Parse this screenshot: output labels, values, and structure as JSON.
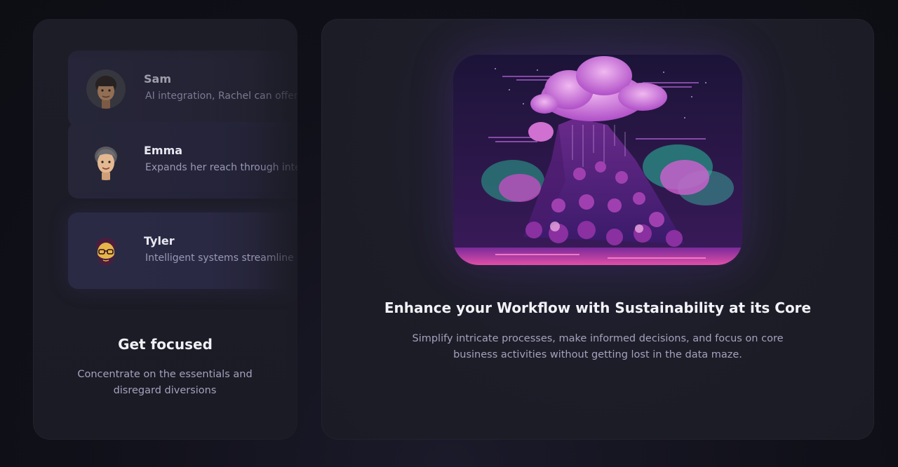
{
  "testimonials": [
    {
      "name": "Sam",
      "quote": "AI integration, Rachel can offer",
      "avatar_icon": "man-avatar-icon"
    },
    {
      "name": "Emma",
      "quote": "Expands her reach through intelligent",
      "avatar_icon": "woman-avatar-icon"
    },
    {
      "name": "Tyler",
      "quote": "Intelligent systems streamline",
      "avatar_icon": "bearded-man-avatar-icon"
    }
  ],
  "left_card": {
    "title": "Get focused",
    "description": "Concentrate on the essentials and disregard diversions"
  },
  "right_card": {
    "title": "Enhance your Workflow with Sustainability at its Core",
    "description": "Simplify intricate processes, make informed decisions, and focus on core business activities without getting lost in the data maze.",
    "image_icon": "cloud-mountain-illustration"
  },
  "colors": {
    "background": "#0f0f17",
    "card": "#1d1d28",
    "accent_purple": "#8b3fd6",
    "text_primary": "#f0f0f6",
    "text_secondary": "#a3a2bd"
  }
}
